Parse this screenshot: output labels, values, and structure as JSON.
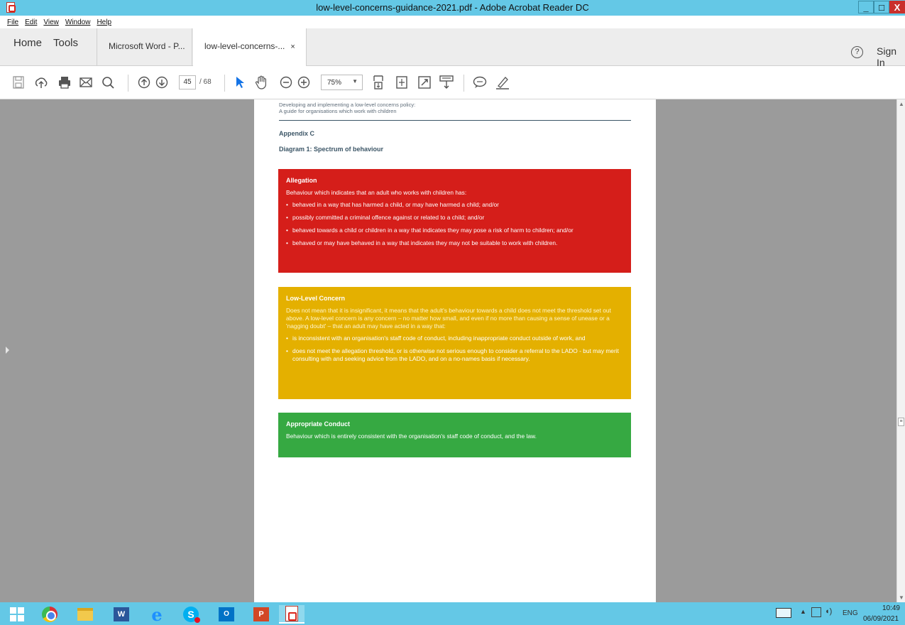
{
  "window": {
    "title": "low-level-concerns-guidance-2021.pdf - Adobe Acrobat Reader DC",
    "min_label": "_",
    "max_label": "□",
    "close_label": "X"
  },
  "menu": [
    "File",
    "Edit",
    "View",
    "Window",
    "Help"
  ],
  "tabs": {
    "home": "Home",
    "tools": "Tools",
    "doc1": "Microsoft Word - P...",
    "doc2": "low-level-concerns-...",
    "doc2_close": "×",
    "help": "?",
    "signin": "Sign In"
  },
  "toolbar": {
    "page_current": "45",
    "page_total": "/ 68",
    "zoom": "75%"
  },
  "document": {
    "header_line1": "Developing and implementing a low-level concerns policy:",
    "header_line2": "A guide for organisations which work with children",
    "appendix": "Appendix C",
    "diagram_title": "Diagram 1: Spectrum of behaviour",
    "allegation": {
      "heading": "Allegation",
      "lead": "Behaviour which indicates that an adult who works with children has:",
      "bullets": [
        "behaved in a way that has harmed a child, or may have harmed a child; and/or",
        "possibly committed a criminal offence against or related to a child; and/or",
        "behaved towards a child or children in a way that indicates they may pose a risk of harm to children; and/or",
        "behaved or may have behaved in a way that indicates they may not be suitable to work with children."
      ]
    },
    "low_level": {
      "heading": "Low-Level Concern",
      "lead": "Does not mean that it is insignificant, it means that the adult's behaviour towards a child does not meet the threshold set out above. A low-level concern is any concern – no matter how small, and even if no more than causing a sense of unease or a 'nagging doubt' – that an adult may have acted in a way that:",
      "bullets": [
        "is inconsistent with an organisation's staff code of conduct, including inappropriate conduct outside of work, and",
        "does not meet the allegation threshold, or is otherwise not serious enough to consider a referral to the LADO - but may merit consulting with and seeking advice from the LADO, and on a no-names basis if necessary."
      ]
    },
    "appropriate": {
      "heading": "Appropriate Conduct",
      "lead": "Behaviour which is entirely consistent with the organisation's staff code of conduct, and the law."
    }
  },
  "tray": {
    "lang": "ENG",
    "time": "10:49",
    "date": "06/09/2021"
  },
  "colors": {
    "allegation": "#d51e1a",
    "low_level": "#e4b000",
    "appropriate": "#36a942",
    "titlebar": "#64c8e6"
  },
  "icons": [
    "save-icon",
    "upload-icon",
    "print-icon",
    "email-icon",
    "search-icon",
    "page-up-icon",
    "page-down-icon",
    "select-cursor-icon",
    "hand-tool-icon",
    "zoom-out-icon",
    "zoom-in-icon",
    "fit-page-icon",
    "scroll-mode-icon",
    "full-screen-icon",
    "read-mode-icon",
    "comment-icon",
    "highlight-pen-icon"
  ]
}
